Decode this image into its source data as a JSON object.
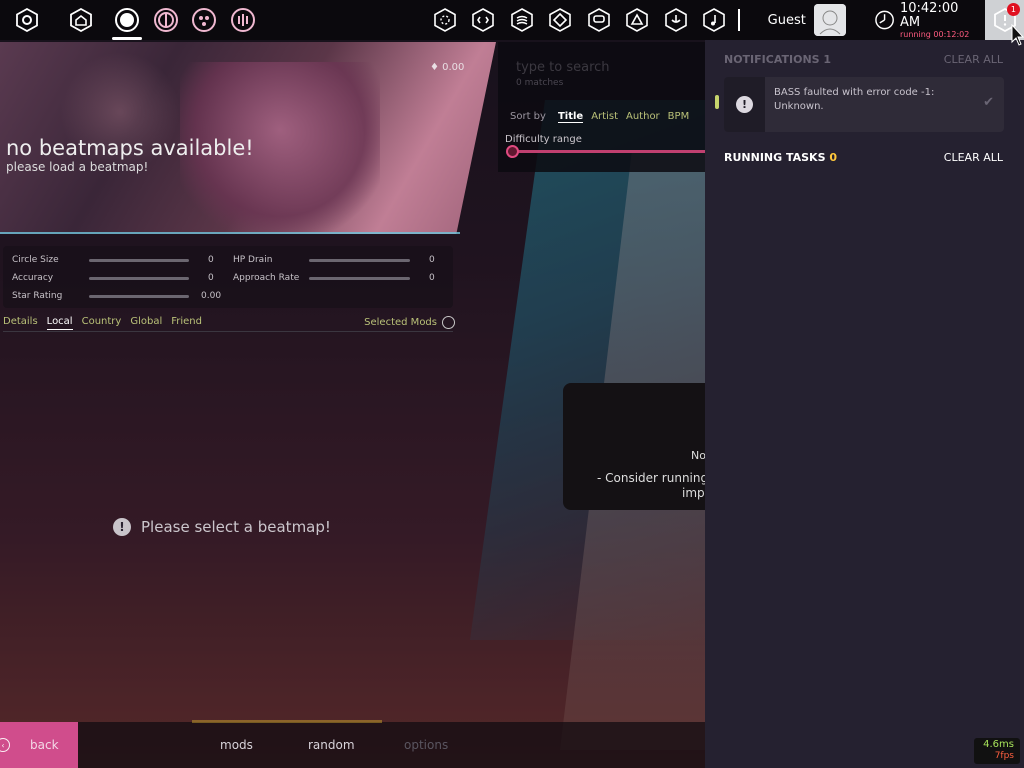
{
  "toolbar": {
    "left_buttons": [
      "settings",
      "home",
      "osu-ruleset",
      "taiko-ruleset",
      "catch-ruleset",
      "mania-ruleset"
    ],
    "right_buttons": [
      "news",
      "chat",
      "rankings",
      "beatmap-listing",
      "wiki",
      "social",
      "changelog",
      "now-playing"
    ],
    "user_name": "Guest",
    "clock_time": "10:42:00 AM",
    "clock_running": "running 00:12:02",
    "notification_count": "1"
  },
  "wedge": {
    "bpm": "♦ 0.00",
    "title": "no beatmaps available!",
    "subtitle": "please load a beatmap!"
  },
  "attributes": {
    "circle_size": {
      "label": "Circle Size",
      "value": "0"
    },
    "accuracy": {
      "label": "Accuracy",
      "value": "0"
    },
    "star_rating": {
      "label": "Star Rating",
      "value": "0.00"
    },
    "hp_drain": {
      "label": "HP Drain",
      "value": "0"
    },
    "approach_rate": {
      "label": "Approach Rate",
      "value": "0"
    }
  },
  "tabs": {
    "items": [
      "Details",
      "Local",
      "Country",
      "Global",
      "Friend"
    ],
    "active": "Local",
    "selected_mods": "Selected Mods"
  },
  "message": "Please select a beatmap!",
  "filter": {
    "search_placeholder": "type to search",
    "matches": "0 matches",
    "sort_by_label": "Sort by",
    "sort_options": [
      "Title",
      "Artist",
      "Author",
      "BPM"
    ],
    "sort_active": "Title",
    "difficulty_label": "Difficulty range"
  },
  "no_beatmaps_dialog": {
    "line1": "No",
    "line2": "- Consider running t",
    "line3": "imp"
  },
  "footer": {
    "back": "back",
    "mods": "mods",
    "random": "random",
    "options": "options"
  },
  "overlay": {
    "notifications_title": "NOTIFICATIONS",
    "notifications_count": "1",
    "clear_all": "CLEAR ALL",
    "notification_message": "BASS faulted with error code -1: Unknown.",
    "running_tasks_title": "RUNNING TASKS",
    "running_tasks_count": "0",
    "clear_all_tasks": "CLEAR ALL"
  },
  "perf": {
    "frame_time": "4.6ms",
    "fps": "7fps"
  },
  "colors": {
    "accent_pink": "#d04d8c",
    "tab_yellow": "#b9c178",
    "notif_badge": "#e01020",
    "overlay_bg": "#252130",
    "tasks_count": "#ffc83c"
  }
}
